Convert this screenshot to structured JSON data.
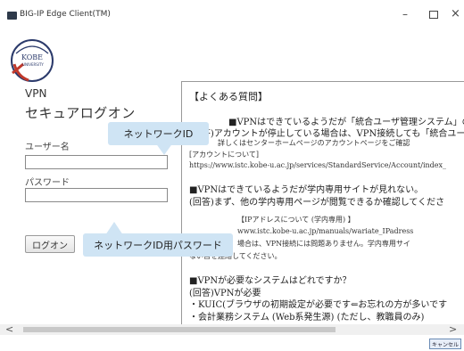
{
  "window": {
    "title": "BIG-IP Edge Client(TM)",
    "minimize_glyph": "–",
    "close_glyph": "×"
  },
  "logo": {
    "text": "KOBE",
    "subtext": "UNIVERSITY"
  },
  "login": {
    "vpn_label": "VPN",
    "heading": "セキュアログオン",
    "username_label": "ユーザー名",
    "username_value": "",
    "password_label": "パスワード",
    "password_value": "",
    "logon_button": "ログオン"
  },
  "callouts": {
    "network_id": "ネットワークID",
    "network_id_password": "ネットワークID用パスワード"
  },
  "faq": {
    "lines": [
      "【よくある質問】",
      "■VPNはできているようだが「統合ユーザ管理システム」のき",
      "(回答)アカウントが停止している場合は、VPN接続しても「統合ユー",
      "詳しくはセンターホームページのアカウントページをご確認",
      "[アカウントについて]",
      "https://www.istc.kobe-u.ac.jp/services/StandardService/Account/index_",
      "■VPNはできているようだが学内専用サイトが見れない。",
      "(回答)まず、他の学内専用ページが閲覧できるか確認してくださ",
      "【IPアドレスについて (学内専用) 】",
      "www.istc.kobe-u.ac.jp/manuals/wariate_IPadress",
      "場合は、VPN接続には問題ありません。学内専用サイ",
      "ない旨を連絡してください。",
      "■VPNが必要なシステムはどれですか？",
      "(回答)VPNが必要",
      "・KUIC(ブラウザの初期設定が必要です⇐お忘れの方が多いです",
      "・会計業務システム (Web系発生源) (ただし、教職員のみ)"
    ]
  },
  "scrollbar": {
    "left_arrow": "<",
    "right_arrow": ">"
  },
  "cancel_button": "キャンセル",
  "colors": {
    "callout_bg": "#cfe4f4",
    "cancel_border": "#6a8bb5",
    "logo_red": "#c0392b",
    "logo_navy": "#2b3a6b"
  }
}
